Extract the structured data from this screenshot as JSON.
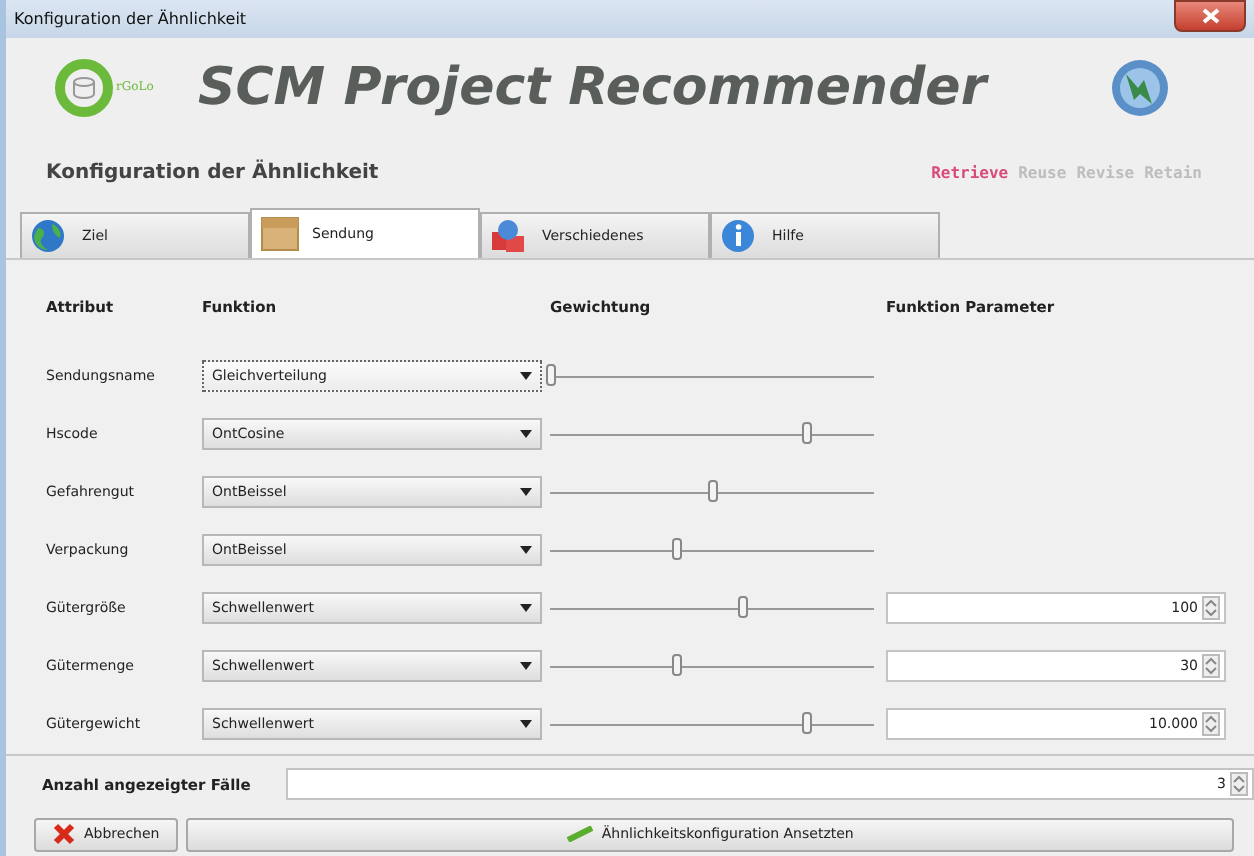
{
  "window": {
    "title": "Konfiguration der Ähnlichkeit"
  },
  "header": {
    "logo_text": "rGoLo",
    "title": "SCM Project Recommender"
  },
  "subtitle": "Konfiguration der Ähnlichkeit",
  "phases": [
    {
      "label": "Retrieve",
      "selected": true
    },
    {
      "label": "Reuse",
      "selected": false
    },
    {
      "label": "Revise",
      "selected": false
    },
    {
      "label": "Retain",
      "selected": false
    }
  ],
  "tabs": [
    {
      "label": "Ziel",
      "kind": "globe",
      "selected": false
    },
    {
      "label": "Sendung",
      "kind": "box",
      "selected": true
    },
    {
      "label": "Verschiedenes",
      "kind": "shapes",
      "selected": false
    },
    {
      "label": "Hilfe",
      "kind": "info",
      "selected": false
    }
  ],
  "table": {
    "columns": [
      "Attribut",
      "Funktion",
      "Gewichtung",
      "Funktion Parameter"
    ],
    "rows": [
      {
        "attribute": "Sendungsname",
        "function": "Gleichverteilung",
        "focused": true,
        "level": 0
      },
      {
        "attribute": "Hscode",
        "function": "OntCosine",
        "focused": false,
        "level": 0.79
      },
      {
        "attribute": "Gefahrengut",
        "function": "OntBeissel",
        "focused": false,
        "level": 0.5
      },
      {
        "attribute": "Verpackung",
        "function": "OntBeissel",
        "focused": false,
        "level": 0.39
      },
      {
        "attribute": "Gütergröße",
        "function": "Schwellenwert",
        "focused": false,
        "level": 0.59,
        "parameter": "100"
      },
      {
        "attribute": "Gütermenge",
        "function": "Schwellenwert",
        "focused": false,
        "level": 0.39,
        "parameter": "30"
      },
      {
        "attribute": "Gütergewicht",
        "function": "Schwellenwert",
        "focused": false,
        "level": 0.79,
        "parameter": "10.000"
      }
    ]
  },
  "case_count": {
    "label": "Anzahl angezeigter Fälle",
    "value": "3"
  },
  "buttons": [
    {
      "label": "Abbrechen",
      "kind": "cancel"
    },
    {
      "label": "Ähnlichkeitskonfiguration Ansetzten",
      "kind": "apply"
    }
  ]
}
